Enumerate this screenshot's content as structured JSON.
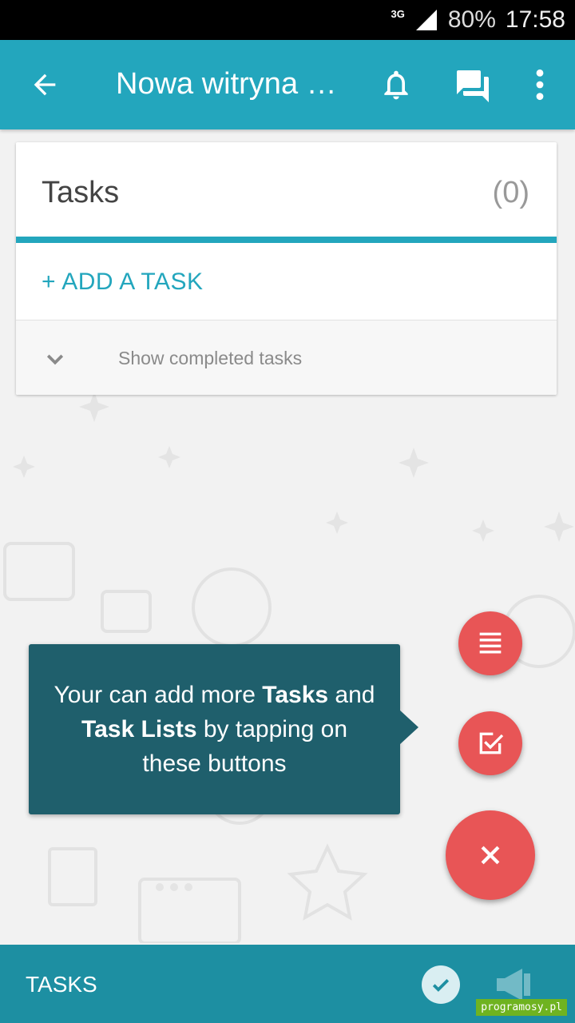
{
  "status_bar": {
    "network": "3G",
    "battery": "80%",
    "time": "17:58"
  },
  "app_bar": {
    "title": "Nowa witryna …"
  },
  "card": {
    "title": "Tasks",
    "count": "(0)",
    "add_task_label": "+ ADD A TASK",
    "show_completed_label": "Show completed tasks"
  },
  "tooltip": {
    "text_before_tasks": "Your can add more ",
    "tasks_bold": "Tasks",
    "text_and": " and ",
    "task_lists_bold": "Task Lists",
    "text_after": " by tapping on these buttons"
  },
  "bottom_bar": {
    "label": "TASKS"
  },
  "watermark": "programosy.pl",
  "colors": {
    "primary": "#23a6bd",
    "tooltip": "#1f5f6c",
    "fab": "#e85556",
    "bottom_bar": "#1d8fa2"
  },
  "icons": [
    "back-arrow-icon",
    "bell-icon",
    "chat-icon",
    "more-vert-icon",
    "chevron-down-icon",
    "list-icon",
    "checkbox-icon",
    "close-icon",
    "check-circle-icon",
    "megaphone-icon"
  ]
}
